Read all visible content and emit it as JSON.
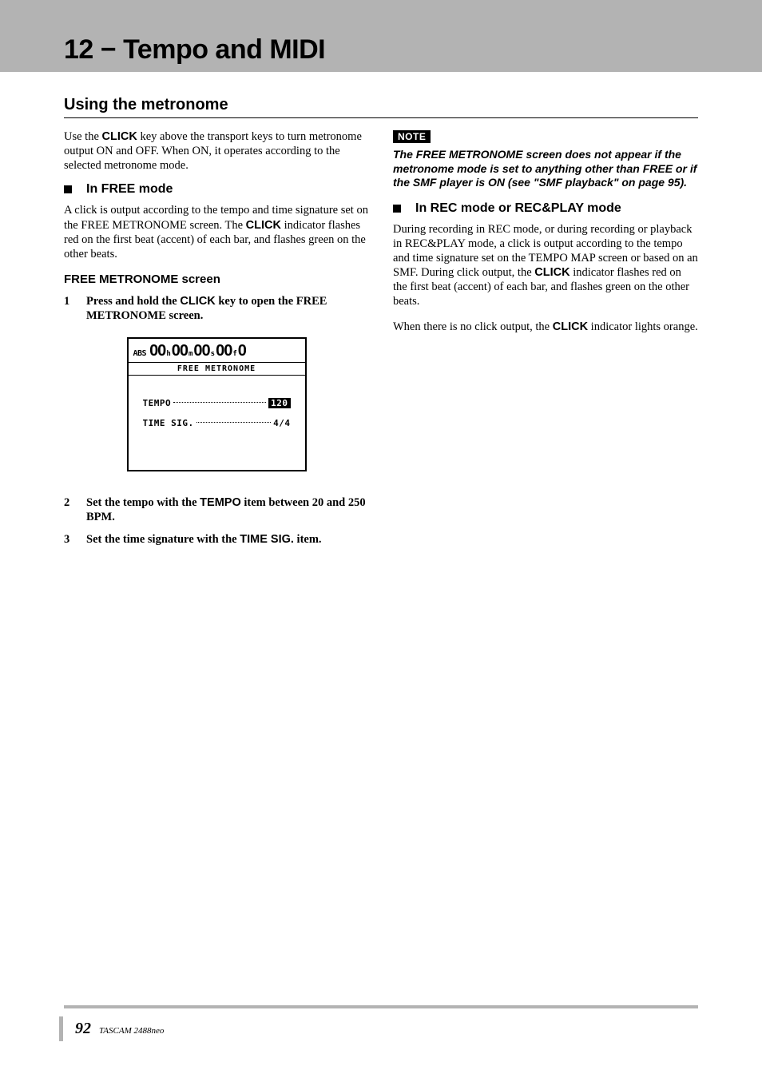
{
  "chapter_title": "12 − Tempo and MIDI",
  "section_heading": "Using the metronome",
  "intro": {
    "before_kbd": "Use the ",
    "kbd1": "CLICK",
    "after_kbd": " key above the transport keys to turn metronome output ON and OFF. When ON, it operates according to the selected metronome mode."
  },
  "free_mode": {
    "heading": "In FREE mode",
    "p1_a": "A click is output according to the tempo and time signature set on the FREE METRONOME screen. The ",
    "p1_kbd": "CLICK",
    "p1_b": " indicator flashes red on the first beat (accent) of each bar, and flashes green on the other beats.",
    "screen_heading": "FREE METRONOME screen",
    "step1": {
      "num": "1",
      "a": "Press and hold the ",
      "kbd": "CLICK",
      "b": " key to open the FREE METRONOME screen."
    },
    "step2": {
      "num": "2",
      "a": "Set the tempo with the ",
      "kbd": "TEMPO",
      "b": " item between 20 and 250 BPM."
    },
    "step3": {
      "num": "3",
      "a": "Set the time signature with the ",
      "kbd": "TIME SIG.",
      "b": " item."
    }
  },
  "lcd": {
    "abs": "ABS",
    "h": "00",
    "hu": "h",
    "m": "00",
    "mu": "m",
    "s": "00",
    "su": "s",
    "f": "00",
    "fu": "f",
    "sub": "0",
    "title": "FREE METRONOME",
    "tempo_label": "TEMPO",
    "tempo_val": "120",
    "timesig_label": "TIME SIG.",
    "timesig_val": "4/4"
  },
  "note": {
    "label": "NOTE",
    "text": "The FREE METRONOME screen does not appear if the metronome mode is set to anything other than FREE or if the SMF player is ON (see \"SMF playback\" on page 95)."
  },
  "rec_mode": {
    "heading": "In REC mode or REC&PLAY mode",
    "p1_a": "During recording in REC mode, or during recording or playback in REC&PLAY mode, a click is output according to the tempo and time signature set on the TEMPO MAP screen or based on an SMF. During click output, the ",
    "p1_kbd": "CLICK",
    "p1_b": " indicator flashes red on the first beat (accent) of each bar, and flashes green on the other beats.",
    "p2_a": "When there is no click output, the ",
    "p2_kbd": "CLICK",
    "p2_b": " indicator lights orange."
  },
  "footer": {
    "page": "92",
    "text": "TASCAM  2488neo"
  }
}
